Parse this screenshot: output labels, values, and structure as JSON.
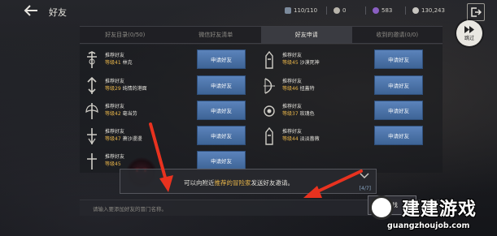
{
  "header": {
    "title": "好友",
    "resources": {
      "energy": "110/110",
      "gold": "0",
      "gem": "583",
      "silver": "130,243"
    },
    "skip_label": "跳过"
  },
  "tabs": [
    {
      "label": "好友目录(0/50)",
      "active": false
    },
    {
      "label": "微信好友清单",
      "active": false
    },
    {
      "label": "好友申请",
      "active": true
    },
    {
      "label": "收到的邀请(0/0)",
      "active": false
    }
  ],
  "recommendations": [
    {
      "tag": "推荐好友",
      "level": "等级41",
      "name": "林克",
      "button": "申请好友",
      "icon": "cross-emblem-icon"
    },
    {
      "tag": "推荐好友",
      "level": "等级45",
      "name": "沙漠死神",
      "button": "申请好友",
      "icon": "tower-emblem-icon"
    },
    {
      "tag": "推荐好友",
      "level": "等级29",
      "name": "纯情的港面",
      "button": "申请好友",
      "icon": "arrow-emblem-icon"
    },
    {
      "tag": "推荐好友",
      "level": "等级46",
      "name": "扭蓋特",
      "button": "申请好友",
      "icon": "bow-emblem-icon"
    },
    {
      "tag": "推荐好友",
      "level": "等级42",
      "name": "毫当劳",
      "button": "申请好友",
      "icon": "axe-emblem-icon"
    },
    {
      "tag": "推荐好友",
      "level": "等级37",
      "name": "玫瑰色",
      "button": "申请好友",
      "icon": "orb-emblem-icon"
    },
    {
      "tag": "推荐好友",
      "level": "等级47",
      "name": "萧沙漫漫",
      "button": "申请好友",
      "icon": "cross-emblem-icon"
    },
    {
      "tag": "推荐好友",
      "level": "等级44",
      "name": "淡淡蔷薇",
      "button": "申请好友",
      "icon": "tower-emblem-icon"
    },
    {
      "tag": "推荐好友",
      "level": "等级45",
      "name": "",
      "button": "申请好友",
      "icon": "cross-emblem-icon"
    }
  ],
  "banner": {
    "prefix": "可以向附近",
    "highlight": "推荐的冒险家",
    "suffix": "发送好友邀请。",
    "count": "[4/7]"
  },
  "search": {
    "placeholder": "请输入要添加好友的冒门名称。",
    "button": "查找"
  },
  "watermark": {
    "text": "建建游戏",
    "url": "guangzhoujob.com"
  },
  "colors": {
    "accent_blue": "#4a72a8",
    "level_gold": "#e9b64a",
    "arrow_red": "#e8321f"
  }
}
